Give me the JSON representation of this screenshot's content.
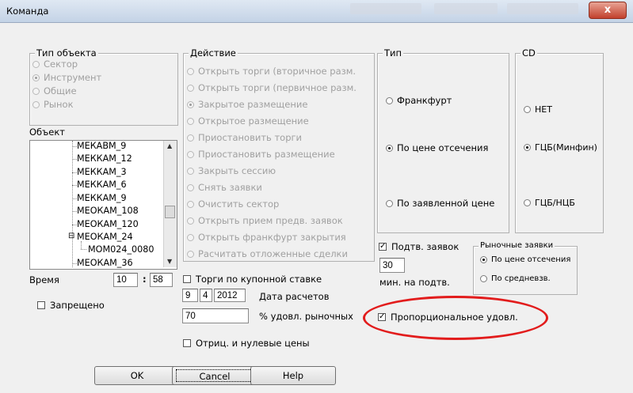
{
  "window": {
    "title": "Команда",
    "close_glyph": "x"
  },
  "object_type": {
    "legend": "Тип объекта",
    "options": [
      {
        "label": "Сектор",
        "selected": false
      },
      {
        "label": "Инструмент",
        "selected": true
      },
      {
        "label": "Общие",
        "selected": false
      },
      {
        "label": "Рынок",
        "selected": false
      }
    ]
  },
  "object": {
    "label": "Объект",
    "tree_items": [
      "МЕКАВМ_9",
      "МЕККАМ_12",
      "МЕККАМ_3",
      "МЕККАМ_6",
      "МЕККАМ_9",
      "МЕОКАМ_108",
      "МЕОКАМ_120",
      "МЕОКАМ_24",
      "МОМ024_0080",
      "МЕОКАМ_36"
    ],
    "expand_glyph": "⊟"
  },
  "action": {
    "legend": "Действие",
    "options": [
      {
        "label": "Открыть торги (вторичное разм.",
        "selected": false
      },
      {
        "label": "Открыть торги (первичное разм.",
        "selected": false
      },
      {
        "label": "Закрытое размещение",
        "selected": true
      },
      {
        "label": "Открытое размещение",
        "selected": false
      },
      {
        "label": "Приостановить торги",
        "selected": false
      },
      {
        "label": "Приостановить размещение",
        "selected": false
      },
      {
        "label": "Закрыть сессию",
        "selected": false
      },
      {
        "label": "Снять заявки",
        "selected": false
      },
      {
        "label": "Очистить сектор",
        "selected": false
      },
      {
        "label": "Открыть прием предв. заявок",
        "selected": false
      },
      {
        "label": "Открыть франкфурт закрытия",
        "selected": false
      },
      {
        "label": "Расчитать отложенные сделки",
        "selected": false
      }
    ]
  },
  "type": {
    "legend": "Тип",
    "options": [
      {
        "label": "Франкфурт",
        "selected": false
      },
      {
        "label": "По цене отсечения",
        "selected": true
      },
      {
        "label": "По заявленной цене",
        "selected": false
      }
    ]
  },
  "cd": {
    "legend": "CD",
    "options": [
      {
        "label": "НЕТ",
        "selected": false
      },
      {
        "label": "ГЦБ(Минфин)",
        "selected": true
      },
      {
        "label": "ГЦБ/НЦБ",
        "selected": false
      }
    ]
  },
  "time": {
    "label": "Время",
    "hours": "10",
    "separator": ":",
    "minutes": "58"
  },
  "forbidden": {
    "label": "Запрещено",
    "checked": false
  },
  "coupon_trading": {
    "label": "Торги по купонной ставке",
    "checked": false
  },
  "settlement": {
    "day": "9",
    "month": "4",
    "year": "2012",
    "label": "Дата расчетов"
  },
  "market_pct": {
    "value": "70",
    "label": "% удовл. рыночных"
  },
  "negative_prices": {
    "label": "Отриц. и нулевые цены",
    "checked": false
  },
  "confirm_orders": {
    "label": "Подтв. заявок",
    "checked": true,
    "minutes_value": "30",
    "minutes_label": "мин. на подтв."
  },
  "market_orders": {
    "legend": "Рыночные заявки",
    "options": [
      {
        "label": "По цене отсечения",
        "selected": true
      },
      {
        "label": "По средневзв.",
        "selected": false
      }
    ]
  },
  "proportional": {
    "label": "Пропорциональное удовл.",
    "checked": true,
    "highlight_color": "#e21c1c"
  },
  "buttons": {
    "ok": "OK",
    "cancel": "Cancel",
    "help": "Help"
  }
}
